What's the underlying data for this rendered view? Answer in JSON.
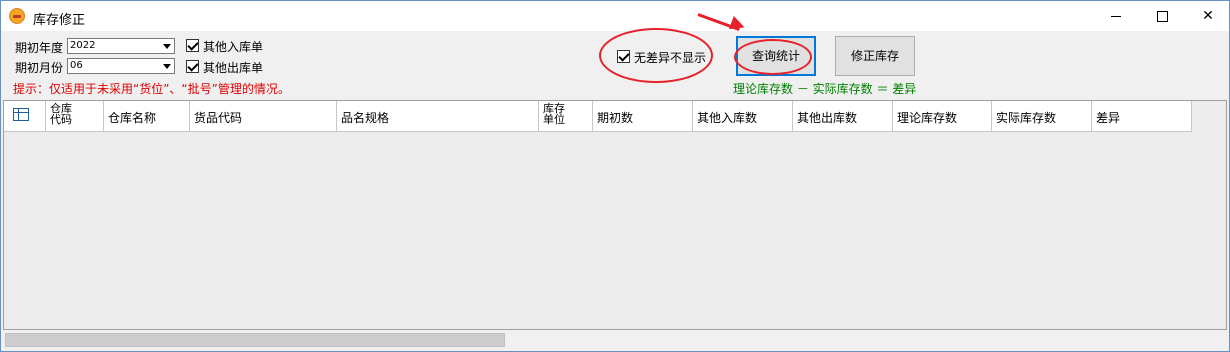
{
  "window": {
    "title": "库存修正"
  },
  "filters": {
    "year_label": "期初年度",
    "year_value": "2022",
    "month_label": "期初月份",
    "month_value": "06",
    "other_in_label": "其他入库单",
    "other_out_label": "其他出库单",
    "no_diff_label": "无差异不显示"
  },
  "hint": "提示：仅适用于未采用“货位”、“批号”管理的情况。",
  "buttons": {
    "query_label": "查询统计",
    "fix_label": "修正库存"
  },
  "formula": "理论库存数 － 实际库存数 ＝ 差异",
  "table": {
    "columns": [
      "仓库代码",
      "仓库名称",
      "货品代码",
      "品名规格",
      "库存单位",
      "期初数",
      "其他入库数",
      "其他出库数",
      "理论库存数",
      "实际库存数",
      "差异"
    ],
    "rows": []
  },
  "colors": {
    "annotation": "#e8202a",
    "hint": "#e00000",
    "formula": "#008000",
    "focus": "#0078d7"
  },
  "annotations": {
    "circles": 2,
    "arrows": 1
  }
}
